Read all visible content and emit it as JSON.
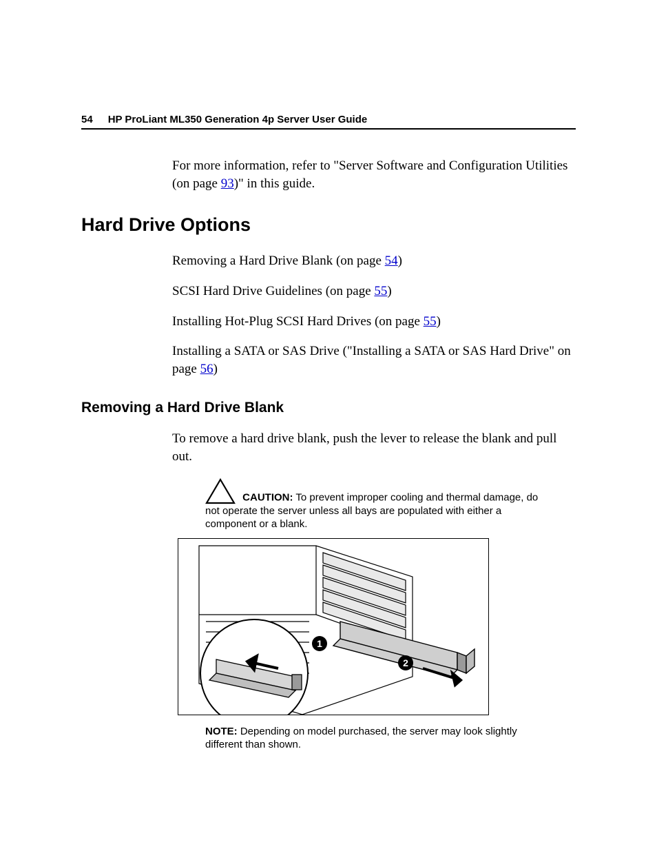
{
  "header": {
    "page_number": "54",
    "title": "HP ProLiant ML350 Generation 4p Server User Guide"
  },
  "intro": {
    "text_before": "For more information, refer to \"Server Software and Configuration Utilities (on page ",
    "link": "93",
    "text_after": ")\" in this guide."
  },
  "h1": "Hard Drive Options",
  "toc": {
    "item1": {
      "before": "Removing a Hard Drive Blank (on page ",
      "link": "54",
      "after": ")"
    },
    "item2": {
      "before": "SCSI Hard Drive Guidelines (on page ",
      "link": "55",
      "after": ")"
    },
    "item3": {
      "before": "Installing Hot-Plug SCSI Hard Drives (on page ",
      "link": "55",
      "after": ")"
    },
    "item4": {
      "before": "Installing a SATA or SAS Drive (\"Installing a SATA or SAS Hard Drive\" on page ",
      "link": "56",
      "after": ")"
    }
  },
  "h2": "Removing a Hard Drive Blank",
  "instruction": "To remove a hard drive blank, push the lever to release the blank and pull out.",
  "caution": {
    "label": "CAUTION:",
    "text": "  To prevent improper cooling and thermal damage, do not operate the server unless all bays are populated with either a component or a blank."
  },
  "figure": {
    "callout1": "1",
    "callout2": "2"
  },
  "note": {
    "label": "NOTE:",
    "text": "  Depending on model purchased, the server may look slightly different than shown."
  }
}
